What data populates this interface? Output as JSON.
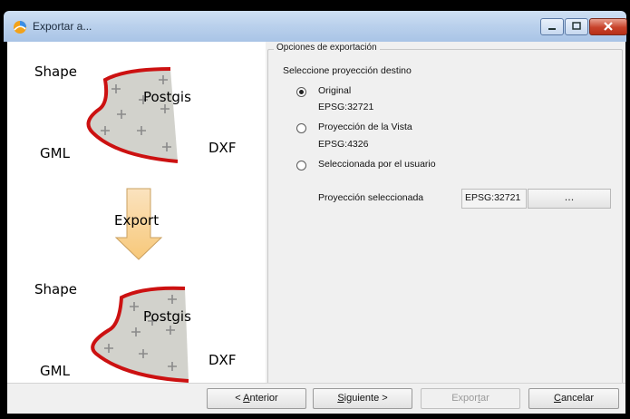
{
  "window": {
    "title": "Exportar a...",
    "colors": {
      "title_bg": "#b9d0ec",
      "close_btn": "#c7422a"
    }
  },
  "illustration": {
    "top": {
      "shape": "Shape",
      "postgis": "Postgis",
      "dxf": "DXF",
      "gml": "GML"
    },
    "arrow_label": "Export",
    "bottom": {
      "shape": "Shape",
      "postgis": "Postgis",
      "dxf": "DXF",
      "gml": "GML"
    }
  },
  "options": {
    "group_title": "Opciones de exportación",
    "select_label": "Seleccione proyección destino",
    "radios": [
      {
        "label": "Original",
        "sub": "EPSG:32721",
        "checked": true
      },
      {
        "label": "Proyección de la Vista",
        "sub": "EPSG:4326",
        "checked": false
      },
      {
        "label": "Seleccionada por el usuario",
        "sub": "",
        "checked": false
      }
    ],
    "selected_projection_label": "Proyección seleccionada",
    "selected_projection_value": "EPSG:32721",
    "browse_label": "..."
  },
  "buttons": {
    "previous": {
      "pre": "< ",
      "u": "A",
      "post": "nterior"
    },
    "next": {
      "pre": "",
      "u": "S",
      "post": "iguiente >"
    },
    "export": {
      "pre": "Expor",
      "u": "t",
      "post": "ar"
    },
    "cancel": {
      "pre": "",
      "u": "C",
      "post": "ancelar"
    }
  }
}
